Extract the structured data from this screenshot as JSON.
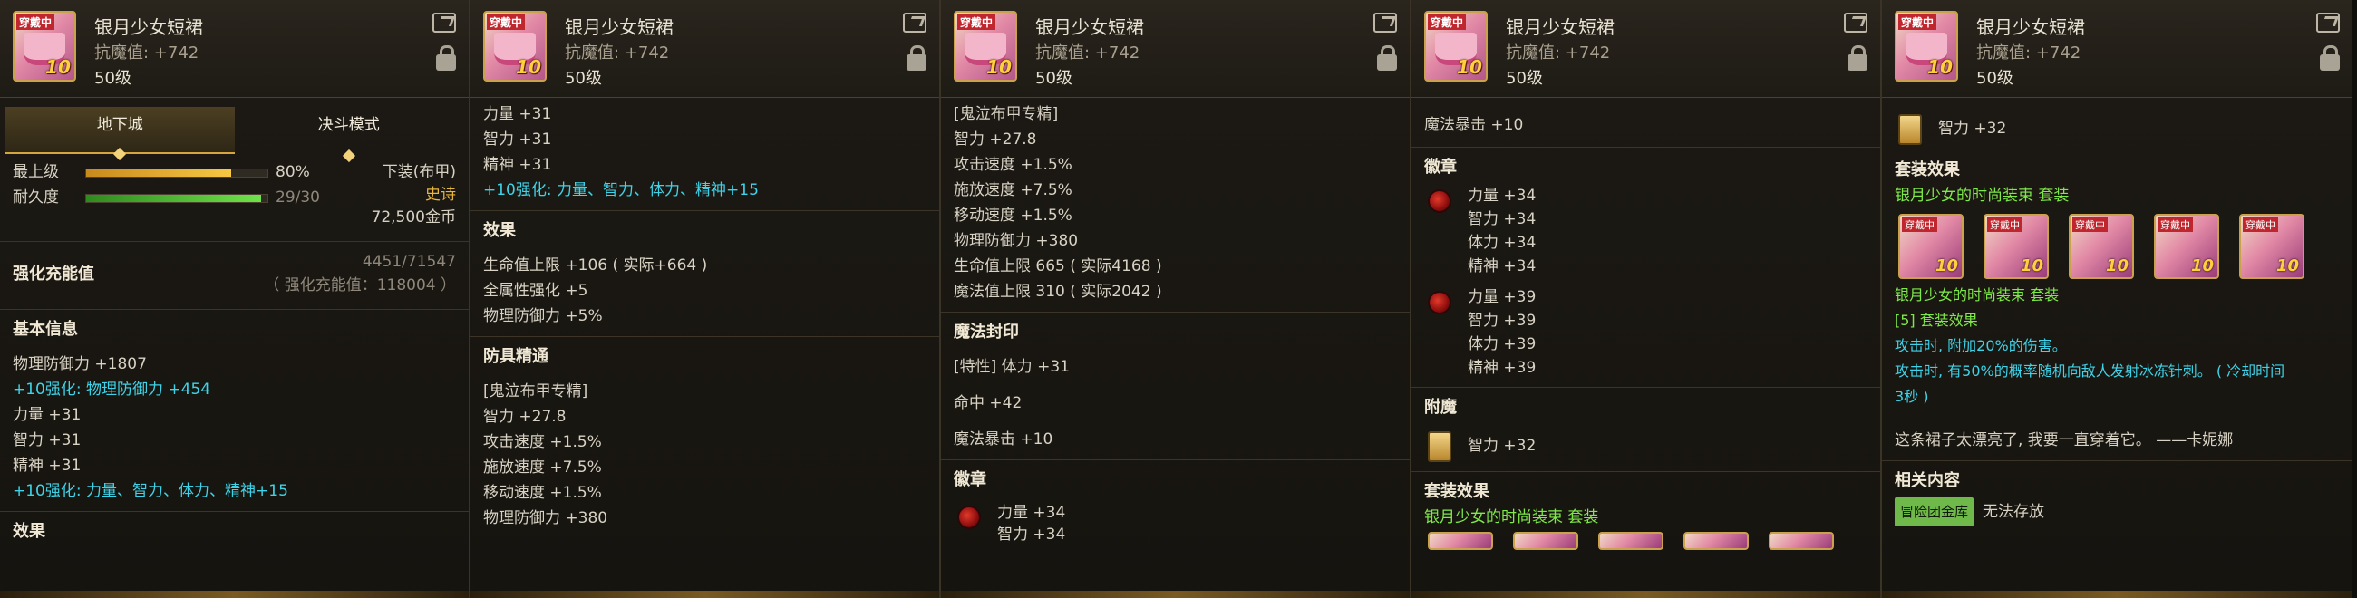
{
  "item": {
    "name": "银月少女短裙",
    "stat": "抗魔值: +742",
    "level": "50级",
    "icon_tag": "穿戴中",
    "icon_enhance": "10",
    "icons": {
      "share": "share-icon",
      "lock": "lock-icon"
    }
  },
  "p1": {
    "tabs": [
      "地下城",
      "决斗模式"
    ],
    "grade_label": "最上级",
    "grade_value": "80%",
    "grade_fill": 0.8,
    "durability_label": "耐久度",
    "durability_value": "29/30",
    "durability_fill": 0.967,
    "slot_type": "下装(布甲)",
    "rarity": "史诗",
    "price": "72,500金币",
    "charge_label": "强化充能值",
    "charge_value": "4451/71547",
    "charge_sub": "（ 强化充能值：118004 ）",
    "basic_title": "基本信息",
    "basic_lines": [
      "物理防御力 +1807"
    ],
    "enh_def": "+10强化: 物理防御力 +454",
    "stats": [
      "力量 +31",
      "智力 +31",
      "精神 +31"
    ],
    "enh_all": "+10强化: 力量、智力、体力、精神+15",
    "effect_title": "效果"
  },
  "p2": {
    "stats": [
      "力量 +31",
      "智力 +31",
      "精神 +31"
    ],
    "enh_all": "+10强化: 力量、智力、体力、精神+15",
    "effect_title": "效果",
    "effect_lines": [
      "生命值上限 +106 ( 实际+664 )",
      "全属性强化 +5",
      "物理防御力 +5%"
    ],
    "mastery_title": "防具精通",
    "mastery_lines": [
      "[鬼泣布甲专精]",
      "智力 +27.8",
      "攻击速度 +1.5%",
      "施放速度 +7.5%",
      "移动速度 +1.5%",
      "物理防御力 +380"
    ]
  },
  "p3": {
    "mastery_lines": [
      "[鬼泣布甲专精]",
      "智力 +27.8",
      "攻击速度 +1.5%",
      "施放速度 +7.5%",
      "移动速度 +1.5%",
      "物理防御力 +380",
      "生命值上限 665 ( 实际4168 )",
      "魔法值上限 310 ( 实际2042 )"
    ],
    "seal_title": "魔法封印",
    "seal_trait": "[特性] 体力 +31",
    "seal_lines": [
      "命中 +42",
      "魔法暴击 +10"
    ],
    "emblem_title": "徽章",
    "emblem_lines": [
      "力量 +34",
      "智力 +34"
    ]
  },
  "p4": {
    "top_line": "魔法暴击 +10",
    "emblem_title": "徽章",
    "emblem1": [
      "力量 +34",
      "智力 +34",
      "体力 +34",
      "精神 +34"
    ],
    "emblem2": [
      "力量 +39",
      "智力 +39",
      "体力 +39",
      "精神 +39"
    ],
    "enchant_title": "附魔",
    "enchant_value": "智力 +32",
    "set_title": "套装效果",
    "set_name": "银月少女的时尚装束 套装"
  },
  "p5": {
    "enchant_value": "智力 +32",
    "set_title": "套装效果",
    "set_name": "银月少女的时尚装束 套装",
    "set_name2": "银月少女的时尚装束 套装",
    "set_count": "[5] 套装效果",
    "set_lines": [
      "攻击时, 附加20%的伤害。",
      "攻击时, 有50%的概率随机向敌人发射冰冻针刺。 ( 冷却时间",
      "3秒 )"
    ],
    "flavor": "这条裙子太漂亮了, 我要一直穿着它。 ——卡妮娜",
    "related_title": "相关内容",
    "storage_tag": "冒险团金库",
    "storage_text": "无法存放"
  }
}
